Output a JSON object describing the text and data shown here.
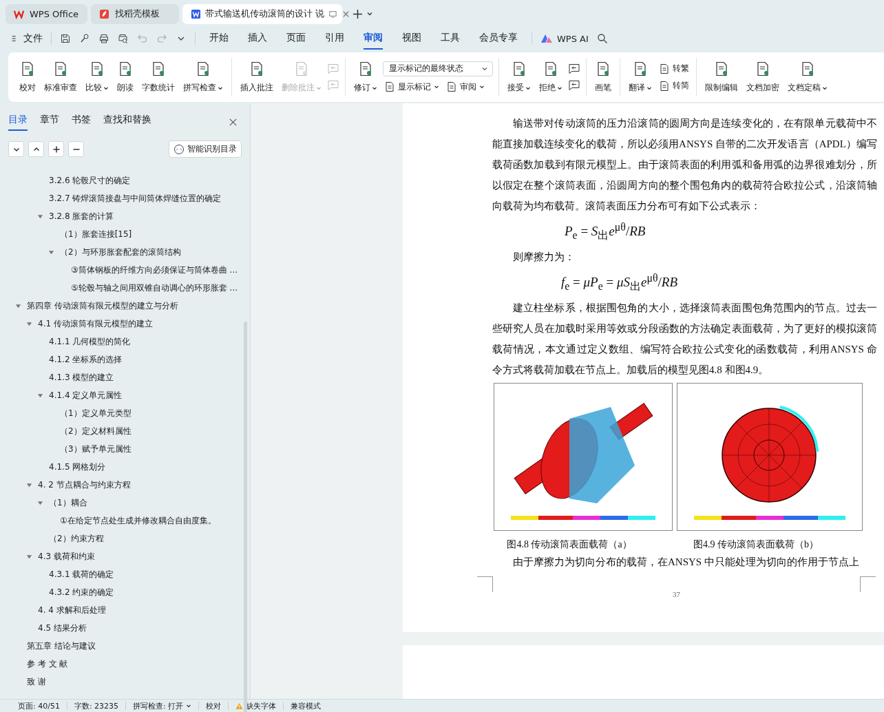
{
  "browser_tabs": [
    {
      "label": "WPS Office",
      "kind": "wps",
      "selected": false
    },
    {
      "label": "找稻壳模板",
      "kind": "docer",
      "selected": false
    },
    {
      "label": "带式输送机传动滚筒的设计 说",
      "kind": "writer",
      "selected": true
    }
  ],
  "quick_menu": {
    "file_label": "文件"
  },
  "menu_tabs": [
    {
      "label": "开始",
      "selected": false
    },
    {
      "label": "插入",
      "selected": false
    },
    {
      "label": "页面",
      "selected": false
    },
    {
      "label": "引用",
      "selected": false
    },
    {
      "label": "审阅",
      "selected": true
    },
    {
      "label": "视图",
      "selected": false
    },
    {
      "label": "工具",
      "selected": false
    },
    {
      "label": "会员专享",
      "selected": false
    }
  ],
  "ai_label": "WPS AI",
  "ribbon": [
    [
      [
        [
          {
            "kind": "large",
            "label": "校对",
            "menu": false,
            "disabled": false
          }
        ]
      ],
      [
        [
          {
            "kind": "large",
            "label": "标准审查",
            "menu": false,
            "disabled": false
          }
        ]
      ],
      [
        [
          {
            "kind": "large",
            "label": "比较",
            "menu": true,
            "disabled": false
          }
        ]
      ],
      [
        [
          {
            "kind": "large",
            "label": "朗读",
            "menu": false,
            "disabled": false
          }
        ]
      ],
      [
        [
          {
            "kind": "large",
            "label": "字数统计",
            "menu": false,
            "disabled": false
          }
        ]
      ],
      [
        [
          {
            "kind": "large",
            "label": "拼写检查",
            "menu": true,
            "disabled": false
          }
        ]
      ]
    ],
    [
      [
        [
          {
            "kind": "large",
            "label": "插入批注",
            "menu": false,
            "disabled": false
          }
        ]
      ],
      [
        [
          {
            "kind": "large",
            "label": "删除批注",
            "menu": true,
            "disabled": true
          }
        ]
      ],
      [
        [
          {
            "kind": "small",
            "disabled": true
          }
        ],
        [
          {
            "kind": "small",
            "disabled": true
          }
        ]
      ]
    ],
    [
      [
        [
          {
            "kind": "large",
            "label": "修订",
            "menu": true,
            "disabled": false
          }
        ]
      ],
      [
        [
          {
            "kind": "select",
            "value": "显示标记的最终状态"
          }
        ],
        [
          {
            "kind": "inline",
            "label": "显示标记",
            "menu": true,
            "disabled": false
          },
          {
            "kind": "inline",
            "label": "审阅",
            "menu": true,
            "disabled": false
          }
        ]
      ]
    ],
    [
      [
        [
          {
            "kind": "large",
            "label": "接受",
            "menu": true,
            "disabled": false
          }
        ]
      ],
      [
        [
          {
            "kind": "large",
            "label": "拒绝",
            "menu": true,
            "disabled": false
          }
        ]
      ],
      [
        [
          {
            "kind": "small",
            "disabled": false
          }
        ],
        [
          {
            "kind": "small",
            "disabled": false
          }
        ]
      ]
    ],
    [
      [
        [
          {
            "kind": "large",
            "label": "画笔",
            "menu": false,
            "disabled": false
          }
        ]
      ]
    ],
    [
      [
        [
          {
            "kind": "large",
            "label": "翻译",
            "menu": true,
            "disabled": false
          }
        ]
      ],
      [
        [
          {
            "kind": "inline",
            "label": "转繁",
            "menu": false,
            "disabled": false
          }
        ],
        [
          {
            "kind": "inline",
            "label": "转简",
            "menu": false,
            "disabled": false
          }
        ]
      ]
    ],
    [
      [
        [
          {
            "kind": "large",
            "label": "限制编辑",
            "menu": false,
            "disabled": false
          }
        ]
      ],
      [
        [
          {
            "kind": "large",
            "label": "文档加密",
            "menu": false,
            "disabled": false
          }
        ]
      ],
      [
        [
          {
            "kind": "large",
            "label": "文档定稿",
            "menu": true,
            "disabled": false
          }
        ]
      ]
    ]
  ],
  "nav_tabs": [
    {
      "label": "目录",
      "selected": true
    },
    {
      "label": "章节",
      "selected": false
    },
    {
      "label": "书签",
      "selected": false
    },
    {
      "label": "查找和替换",
      "selected": false
    }
  ],
  "smart_toc_button": "智能识别目录",
  "toc_continued": [
    {
      "label": "3.2.6  轮毂尺寸的确定"
    },
    {
      "label": "3.2.7  铸焊滚筒接盘与中间筒体焊缝位置的确定"
    },
    {
      "label": "3.2.8  胀套的计算",
      "expanded": true,
      "children": [
        {
          "label": "（1）胀套连接[15]"
        },
        {
          "label": "（2）与环形胀套配套的滚筒结构",
          "expanded": true,
          "children": [
            {
              "label": "③筒体钢板的纤维方向必须保证与筒体卷曲 ..."
            },
            {
              "label": "⑤轮毂与轴之间用双锥自动调心的环形胀套 ..."
            }
          ]
        }
      ]
    }
  ],
  "toc": [
    {
      "label": "第四章  传动滚筒有限元模型的建立与分析",
      "expanded": true,
      "children": [
        {
          "label": "4.1  传动滚筒有限元模型的建立",
          "expanded": true,
          "children": [
            {
              "label": "4.1.1  几何模型的简化"
            },
            {
              "label": "4.1.2  坐标系的选择"
            },
            {
              "label": "4.1.3  模型的建立"
            },
            {
              "label": "4.1.4  定义单元属性",
              "expanded": true,
              "children": [
                {
                  "label": "（1）定义单元类型"
                },
                {
                  "label": "（2）定义材料属性"
                },
                {
                  "label": "（3）赋予单元属性"
                }
              ]
            },
            {
              "label": "4.1.5  网格划分"
            }
          ]
        },
        {
          "label": "4. 2  节点耦合与约束方程",
          "expanded": true,
          "children": [
            {
              "label": "（1）耦合",
              "expanded": true,
              "children": [
                {
                  "label": "①在给定节点处生成并修改耦合自由度集。"
                }
              ]
            },
            {
              "label": "（2）约束方程"
            }
          ]
        },
        {
          "label": "4.3  载荷和约束",
          "expanded": true,
          "children": [
            {
              "label": "4.3.1  载荷的确定"
            },
            {
              "label": "4.3.2  约束的确定"
            }
          ]
        },
        {
          "label": "4. 4  求解和后处理"
        },
        {
          "label": "4.5  结果分析"
        }
      ]
    },
    {
      "label": "第五章  结论与建议"
    },
    {
      "label": "参 考 文 献"
    },
    {
      "label": "致    谢"
    }
  ],
  "document": [
    {
      "kind": "paragraph",
      "text": "输送带对传动滚筒的压力沿滚筒的圆周方向是连续变化的，在有限单元载荷中不能直接加载连续变化的载荷，所以必须用ANSYS 自带的二次开发语言（APDL）编写载荷函数加载到有限元模型上。由于滚筒表面的利用弧和备用弧的边界很难划分，所以假定在整个滚筒表面，沿圆周方向的整个围包角内的载荷符合欧拉公式，沿滚筒轴向载荷为均布载荷。滚筒表面压力分布可有如下公式表示："
    },
    {
      "kind": "formula",
      "text": "*P*$_{e}$ = *S*$_{出}$*e*$^{μθ}$/*RB*"
    },
    {
      "kind": "paragraph",
      "text": "则摩擦力为："
    },
    {
      "kind": "formula",
      "text": "*f*$_{e}$ = *μP*$_{e}$ = *μS*$_{出}$*e*$^{μθ}$/*RB*"
    },
    {
      "kind": "paragraph",
      "text": "建立柱坐标系，根据围包角的大小，选择滚筒表面围包角范围内的节点。过去一些研究人员在加载时采用等效或分段函数的方法确定表面载荷，为了更好的模拟滚筒载荷情况，本文通过定义数组、编写符合欧拉公式变化的函数载荷，利用ANSYS 命令方式将载荷加载在节点上。加载后的模型见图4.8 和图4.9。"
    },
    {
      "kind": "figures",
      "items": [
        {
          "caption": "图4.8  传动滚筒表面载荷（a）"
        },
        {
          "caption": "图4.9  传动滚筒表面载荷（b）"
        }
      ]
    },
    {
      "kind": "paragraph",
      "text": "由于摩擦力为切向分布的载荷，在ANSYS 中只能处理为切向的作用于节点上"
    }
  ],
  "page_number": "37",
  "status_bar": [
    {
      "label": "页面: 40/51",
      "kind": "text"
    },
    {
      "label": "字数: 23235",
      "kind": "text"
    },
    {
      "label": "拼写检查: 打开",
      "kind": "menu"
    },
    {
      "label": "校对",
      "kind": "text"
    },
    {
      "label": "缺失字体",
      "kind": "warning"
    },
    {
      "label": "兼容模式",
      "kind": "text"
    }
  ]
}
